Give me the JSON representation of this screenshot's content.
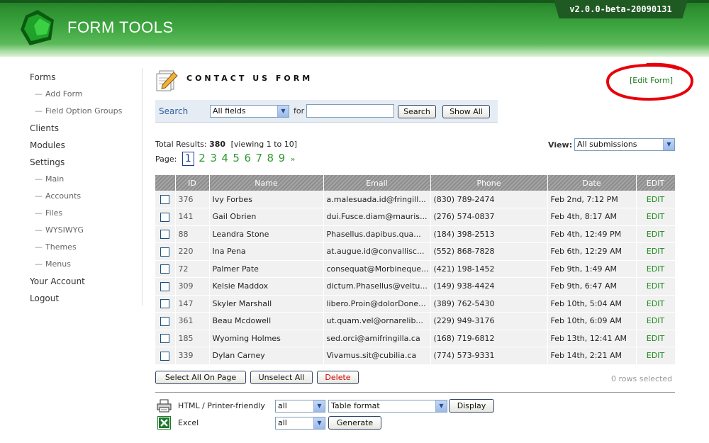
{
  "header": {
    "brand": "FORM TOOLS",
    "version": "v2.0.0-beta-20090131"
  },
  "nav": {
    "items": [
      {
        "label": "Forms",
        "sub": false
      },
      {
        "label": "Add Form",
        "sub": true
      },
      {
        "label": "Field Option Groups",
        "sub": true
      },
      {
        "label": "Clients",
        "sub": false
      },
      {
        "label": "Modules",
        "sub": false
      },
      {
        "label": "Settings",
        "sub": false
      },
      {
        "label": "Main",
        "sub": true
      },
      {
        "label": "Accounts",
        "sub": true
      },
      {
        "label": "Files",
        "sub": true
      },
      {
        "label": "WYSIWYG",
        "sub": true
      },
      {
        "label": "Themes",
        "sub": true
      },
      {
        "label": "Menus",
        "sub": true
      },
      {
        "label": "Your Account",
        "sub": false
      },
      {
        "label": "Logout",
        "sub": false
      }
    ]
  },
  "page": {
    "title": "CONTACT US FORM",
    "edit_link": "[Edit Form]"
  },
  "search": {
    "label": "Search",
    "field_select": "All fields",
    "for_label": "for",
    "query": "",
    "search_button": "Search",
    "show_all_button": "Show All"
  },
  "results": {
    "total_label": "Total Results:",
    "total": "380",
    "viewing": "[viewing 1 to 10]",
    "page_label": "Page:",
    "current_page": "1",
    "pages": [
      "2",
      "3",
      "4",
      "5",
      "6",
      "7",
      "8",
      "9"
    ],
    "next": "»",
    "view_label": "View:",
    "view_select": "All submissions"
  },
  "table": {
    "columns": [
      "",
      "ID",
      "Name",
      "Email",
      "Phone",
      "Date",
      "EDIT"
    ],
    "rows": [
      {
        "id": "376",
        "name": "Ivy Forbes",
        "email": "a.malesuada.id@fringill...",
        "phone": "(830) 789-2474",
        "date": "Feb 2nd, 7:12 PM",
        "edit": "EDIT"
      },
      {
        "id": "141",
        "name": "Gail Obrien",
        "email": "dui.Fusce.diam@mauris...",
        "phone": "(276) 574-0837",
        "date": "Feb 4th, 8:17 AM",
        "edit": "EDIT"
      },
      {
        "id": "88",
        "name": "Leandra Stone",
        "email": "Phasellus.dapibus.qua...",
        "phone": "(184) 398-2513",
        "date": "Feb 4th, 12:49 PM",
        "edit": "EDIT"
      },
      {
        "id": "220",
        "name": "Ina Pena",
        "email": "at.augue.id@convallisc...",
        "phone": "(552) 868-7828",
        "date": "Feb 6th, 12:29 AM",
        "edit": "EDIT"
      },
      {
        "id": "72",
        "name": "Palmer Pate",
        "email": "consequat@Morbineque...",
        "phone": "(421) 198-1452",
        "date": "Feb 9th, 1:49 AM",
        "edit": "EDIT"
      },
      {
        "id": "309",
        "name": "Kelsie Maddox",
        "email": "dictum.Phasellus@veltu...",
        "phone": "(149) 938-4424",
        "date": "Feb 9th, 6:47 AM",
        "edit": "EDIT"
      },
      {
        "id": "147",
        "name": "Skyler Marshall",
        "email": "libero.Proin@dolorDone...",
        "phone": "(389) 762-5430",
        "date": "Feb 10th, 5:04 AM",
        "edit": "EDIT"
      },
      {
        "id": "361",
        "name": "Beau Mcdowell",
        "email": "ut.quam.vel@ornarelib...",
        "phone": "(229) 949-3176",
        "date": "Feb 10th, 6:09 AM",
        "edit": "EDIT"
      },
      {
        "id": "185",
        "name": "Wyoming Holmes",
        "email": "sed.orci@amifringilla.ca",
        "phone": "(168) 719-6812",
        "date": "Feb 13th, 12:41 AM",
        "edit": "EDIT"
      },
      {
        "id": "339",
        "name": "Dylan Carney",
        "email": "Vivamus.sit@cubilia.ca",
        "phone": "(774) 573-9331",
        "date": "Feb 14th, 2:21 AM",
        "edit": "EDIT"
      }
    ]
  },
  "actions": {
    "select_all": "Select All On Page",
    "unselect_all": "Unselect All",
    "delete": "Delete",
    "rows_selected": "0 rows selected"
  },
  "export": {
    "html_label": "HTML / Printer-friendly",
    "html_scope": "all",
    "html_format": "Table format",
    "display_button": "Display",
    "excel_label": "Excel",
    "excel_scope": "all",
    "generate_button": "Generate"
  },
  "colors": {
    "accent": "#3fa741",
    "link": "#1b8a1b",
    "header_dark": "#1f5a22",
    "delete": "#cc0000",
    "annotation": "#e8000b"
  }
}
